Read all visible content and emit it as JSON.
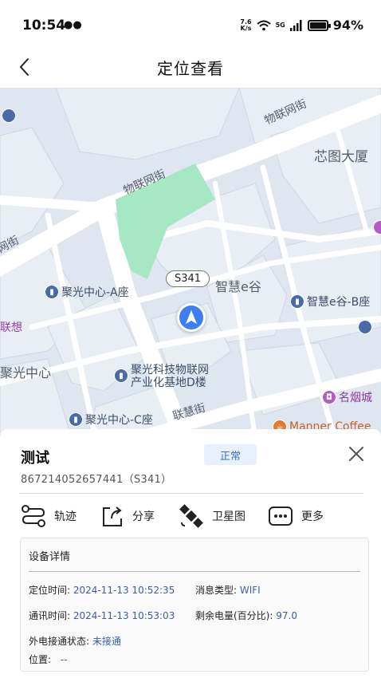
{
  "status_bar": {
    "time": "10:54",
    "speed_value": "7.6",
    "speed_unit": "K/s",
    "network": "5G",
    "battery": "94%",
    "battery_level": 0.94
  },
  "nav": {
    "title": "定位查看"
  },
  "map": {
    "road_badge": "S341",
    "labels": {
      "street_1": "物联网街",
      "street_2": "物联网街",
      "street_3": "网街",
      "street_4": "联慧街",
      "building_1": "芯图大厦",
      "building_2": "智慧e谷",
      "area_1": "聚光中心",
      "area_2": "联想"
    },
    "pois": {
      "poi_1": "聚光中心-A座",
      "poi_2": "智慧e谷-B座",
      "poi_3_line1": "聚光科技物联网",
      "poi_3_line2": "产业化基地D楼",
      "poi_4": "聚光中心-C座",
      "poi_5": "名烟城",
      "poi_6": "Manner Coffee"
    }
  },
  "device": {
    "name": "测试",
    "status": "正常",
    "id": "867214052657441（S341）"
  },
  "actions": {
    "track": "轨迹",
    "share": "分享",
    "satellite": "卫星图",
    "more": "更多"
  },
  "details": {
    "title": "设备详情",
    "locate_time_label": "定位时间:",
    "locate_time": "2024-11-13 10:52:35",
    "msg_type_label": "消息类型:",
    "msg_type": "WIFI",
    "comm_time_label": "通讯时间:",
    "comm_time": "2024-11-13 10:53:03",
    "battery_label": "剩余电量(百分比):",
    "battery_value": "97.0",
    "power_label": "外电接通状态:",
    "power_value": "未接通",
    "position_label": "位置:",
    "position_value": "--"
  },
  "colors": {
    "accent": "#3b7ff0",
    "badge_bg": "#e8f0fb",
    "badge_text": "#3d6fd1",
    "map_bg": "#dfe6ef",
    "park_green": "#a6e8c3"
  }
}
